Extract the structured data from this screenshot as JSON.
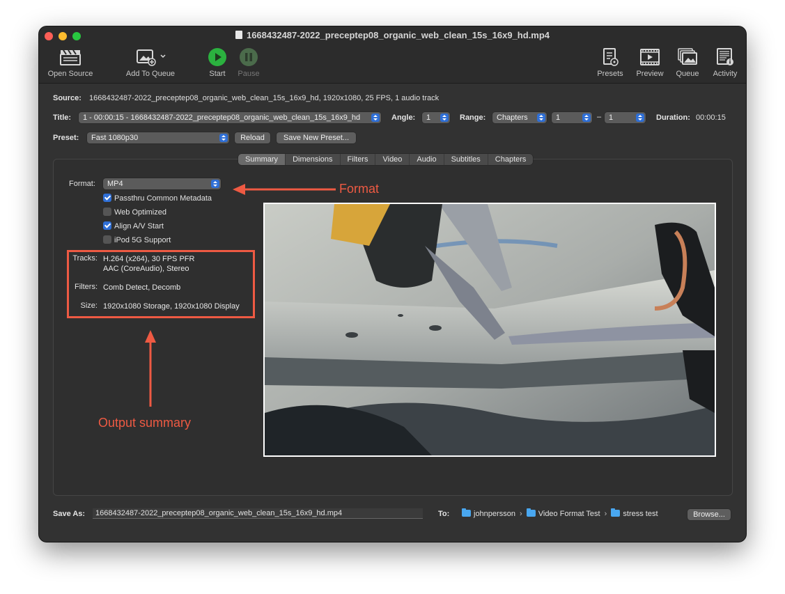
{
  "window": {
    "title": "1668432487-2022_preceptep08_organic_web_clean_15s_16x9_hd.mp4"
  },
  "toolbar": {
    "open_source": "Open Source",
    "add_to_queue": "Add To Queue",
    "start": "Start",
    "pause": "Pause",
    "presets": "Presets",
    "preview": "Preview",
    "queue": "Queue",
    "activity": "Activity",
    "colors": {
      "start_green": "#2bb13f",
      "pause_disabled": "#4b6b4b"
    }
  },
  "source": {
    "label": "Source:",
    "value": "1668432487-2022_preceptep08_organic_web_clean_15s_16x9_hd, 1920x1080, 25 FPS, 1 audio track"
  },
  "title_row": {
    "title_label": "Title:",
    "title_value": "1 - 00:00:15 - 1668432487-2022_preceptep08_organic_web_clean_15s_16x9_hd",
    "angle_label": "Angle:",
    "angle_value": "1",
    "range_label": "Range:",
    "range_value": "Chapters",
    "range_start": "1",
    "range_dash": "–",
    "range_end": "1",
    "duration_label": "Duration:",
    "duration_value": "00:00:15"
  },
  "preset_row": {
    "label": "Preset:",
    "value": "Fast 1080p30",
    "reload": "Reload",
    "save_new": "Save New Preset..."
  },
  "tabs": [
    "Summary",
    "Dimensions",
    "Filters",
    "Video",
    "Audio",
    "Subtitles",
    "Chapters"
  ],
  "summary": {
    "format_label": "Format:",
    "format_value": "MP4",
    "checkboxes": [
      {
        "label": "Passthru Common Metadata",
        "checked": true
      },
      {
        "label": "Web Optimized",
        "checked": false
      },
      {
        "label": "Align A/V Start",
        "checked": true
      },
      {
        "label": "iPod 5G Support",
        "checked": false
      }
    ],
    "tracks_label": "Tracks:",
    "tracks_line1": "H.264 (x264), 30 FPS PFR",
    "tracks_line2": "AAC (CoreAudio), Stereo",
    "filters_label": "Filters:",
    "filters_value": "Comb Detect, Decomb",
    "size_label": "Size:",
    "size_value": "1920x1080 Storage, 1920x1080 Display"
  },
  "annotations": {
    "format": "Format",
    "output_summary": "Output summary",
    "color": "#ee5a43"
  },
  "save_row": {
    "label": "Save As:",
    "value": "1668432487-2022_preceptep08_organic_web_clean_15s_16x9_hd.mp4",
    "to_label": "To:",
    "path": [
      "johnpersson",
      "Video Format Test",
      "stress test"
    ],
    "separator": "›",
    "browse": "Browse..."
  }
}
